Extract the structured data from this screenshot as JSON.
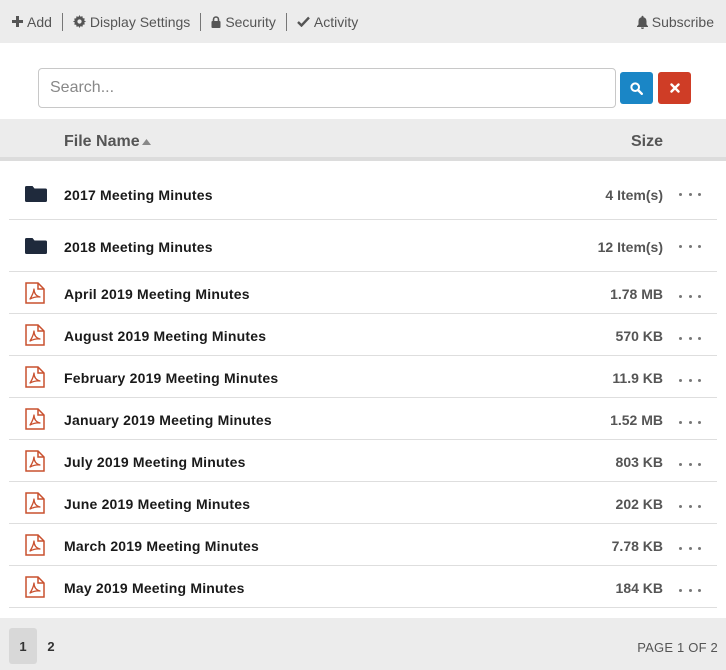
{
  "toolbar": {
    "add_label": "Add",
    "display_settings_label": "Display Settings",
    "security_label": "Security",
    "activity_label": "Activity",
    "subscribe_label": "Subscribe"
  },
  "search": {
    "placeholder": "Search...",
    "value": ""
  },
  "grid": {
    "col_name": "File Name",
    "col_size": "Size",
    "rows": [
      {
        "type": "folder",
        "name": "2017 Meeting Minutes",
        "size": "4 Item(s)"
      },
      {
        "type": "folder",
        "name": "2018 Meeting Minutes",
        "size": "12 Item(s)"
      },
      {
        "type": "pdf",
        "name": "April 2019 Meeting Minutes",
        "size": "1.78 MB"
      },
      {
        "type": "pdf",
        "name": "August 2019 Meeting Minutes",
        "size": "570 KB"
      },
      {
        "type": "pdf",
        "name": "February 2019 Meeting Minutes",
        "size": "11.9 KB"
      },
      {
        "type": "pdf",
        "name": "January 2019 Meeting Minutes",
        "size": "1.52 MB"
      },
      {
        "type": "pdf",
        "name": "July 2019 Meeting Minutes",
        "size": "803 KB"
      },
      {
        "type": "pdf",
        "name": "June 2019 Meeting Minutes",
        "size": "202 KB"
      },
      {
        "type": "pdf",
        "name": "March 2019 Meeting Minutes",
        "size": "7.78 KB"
      },
      {
        "type": "pdf",
        "name": "May 2019 Meeting Minutes",
        "size": "184 KB"
      }
    ]
  },
  "pager": {
    "pages": [
      "1",
      "2"
    ],
    "current_page": "1",
    "info": "PAGE 1 OF 2"
  },
  "colors": {
    "search_button": "#1a86c6",
    "clear_button": "#cf3d26",
    "folder_icon": "#1f2a3c",
    "pdf_icon": "#c9502e",
    "toolbar_bg": "#ececec"
  }
}
